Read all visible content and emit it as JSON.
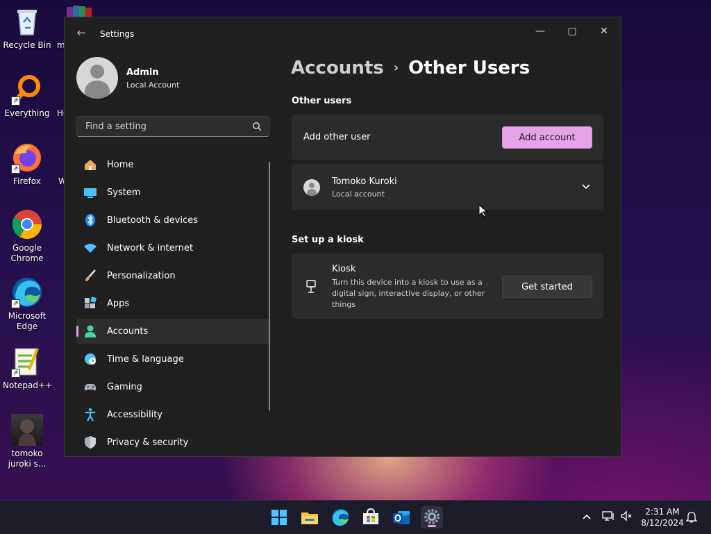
{
  "desktop": {
    "icons": [
      {
        "label": "Recycle Bin"
      },
      {
        "label": "Everything"
      },
      {
        "label": "Firefox"
      },
      {
        "label": "Google Chrome"
      },
      {
        "label": "Microsoft Edge"
      },
      {
        "label": "Notepad++"
      },
      {
        "label": "tomoko juroki s..."
      }
    ],
    "partial_labels": [
      "m",
      "HC",
      "W"
    ]
  },
  "window": {
    "title": "Settings",
    "controls": {
      "minimize": "—",
      "maximize": "▢",
      "close": "✕"
    }
  },
  "profile": {
    "name": "Admin",
    "account_type": "Local Account"
  },
  "search": {
    "placeholder": "Find a setting"
  },
  "nav": {
    "items": [
      {
        "label": "Home",
        "icon": "home-icon"
      },
      {
        "label": "System",
        "icon": "monitor-icon"
      },
      {
        "label": "Bluetooth & devices",
        "icon": "bluetooth-icon"
      },
      {
        "label": "Network & internet",
        "icon": "wifi-icon"
      },
      {
        "label": "Personalization",
        "icon": "brush-icon"
      },
      {
        "label": "Apps",
        "icon": "apps-icon"
      },
      {
        "label": "Accounts",
        "icon": "person-icon",
        "selected": true
      },
      {
        "label": "Time & language",
        "icon": "globe-clock-icon"
      },
      {
        "label": "Gaming",
        "icon": "gamepad-icon"
      },
      {
        "label": "Accessibility",
        "icon": "accessibility-icon"
      },
      {
        "label": "Privacy & security",
        "icon": "shield-icon"
      }
    ]
  },
  "breadcrumb": {
    "parent": "Accounts",
    "separator": "›",
    "current": "Other Users"
  },
  "other_users": {
    "heading": "Other users",
    "add_label": "Add other user",
    "add_button": "Add account",
    "user": {
      "name": "Tomoko Kuroki",
      "type": "Local account"
    }
  },
  "kiosk": {
    "heading": "Set up a kiosk",
    "title": "Kiosk",
    "description_lines": [
      "Turn this device into a kiosk to use as a",
      "digital sign, interactive display, or other",
      "things"
    ],
    "button": "Get started"
  },
  "taskbar": {
    "time": "2:31 AM",
    "date": "8/12/2024",
    "apps": [
      "start-icon",
      "file-explorer-icon",
      "edge-icon",
      "store-icon",
      "outlook-icon",
      "settings-icon"
    ]
  },
  "colors": {
    "accent": "#e6a3e8",
    "window_bg": "#202020",
    "card_bg": "#2b2b2b"
  }
}
